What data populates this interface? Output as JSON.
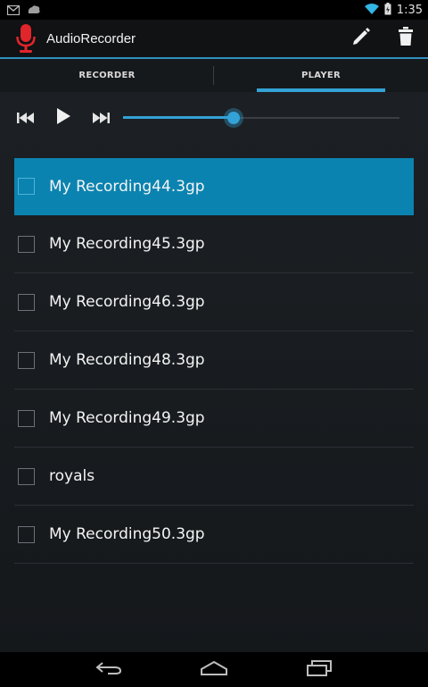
{
  "status_bar": {
    "time": "1:35",
    "icons": [
      "gmail-icon",
      "notification-icon",
      "wifi-icon",
      "battery-charging-icon"
    ]
  },
  "action_bar": {
    "title": "AudioRecorder",
    "actions": [
      "edit-icon",
      "delete-icon"
    ]
  },
  "tabs": [
    {
      "label": "RECORDER",
      "selected": false
    },
    {
      "label": "PLAYER",
      "selected": true
    }
  ],
  "player": {
    "controls": [
      "previous-icon",
      "play-icon",
      "next-icon"
    ],
    "progress": 0.4
  },
  "recordings": [
    {
      "name": "My Recording44.3gp",
      "selected": true,
      "checked": false
    },
    {
      "name": "My Recording45.3gp",
      "selected": false,
      "checked": false
    },
    {
      "name": "My Recording46.3gp",
      "selected": false,
      "checked": false
    },
    {
      "name": "My Recording48.3gp",
      "selected": false,
      "checked": false
    },
    {
      "name": "My Recording49.3gp",
      "selected": false,
      "checked": false
    },
    {
      "name": "royals",
      "selected": false,
      "checked": false
    },
    {
      "name": "My Recording50.3gp",
      "selected": false,
      "checked": false
    }
  ],
  "colors": {
    "accent": "#33a2d6",
    "selection": "#0b83b0",
    "mic_red": "#e0252b"
  }
}
